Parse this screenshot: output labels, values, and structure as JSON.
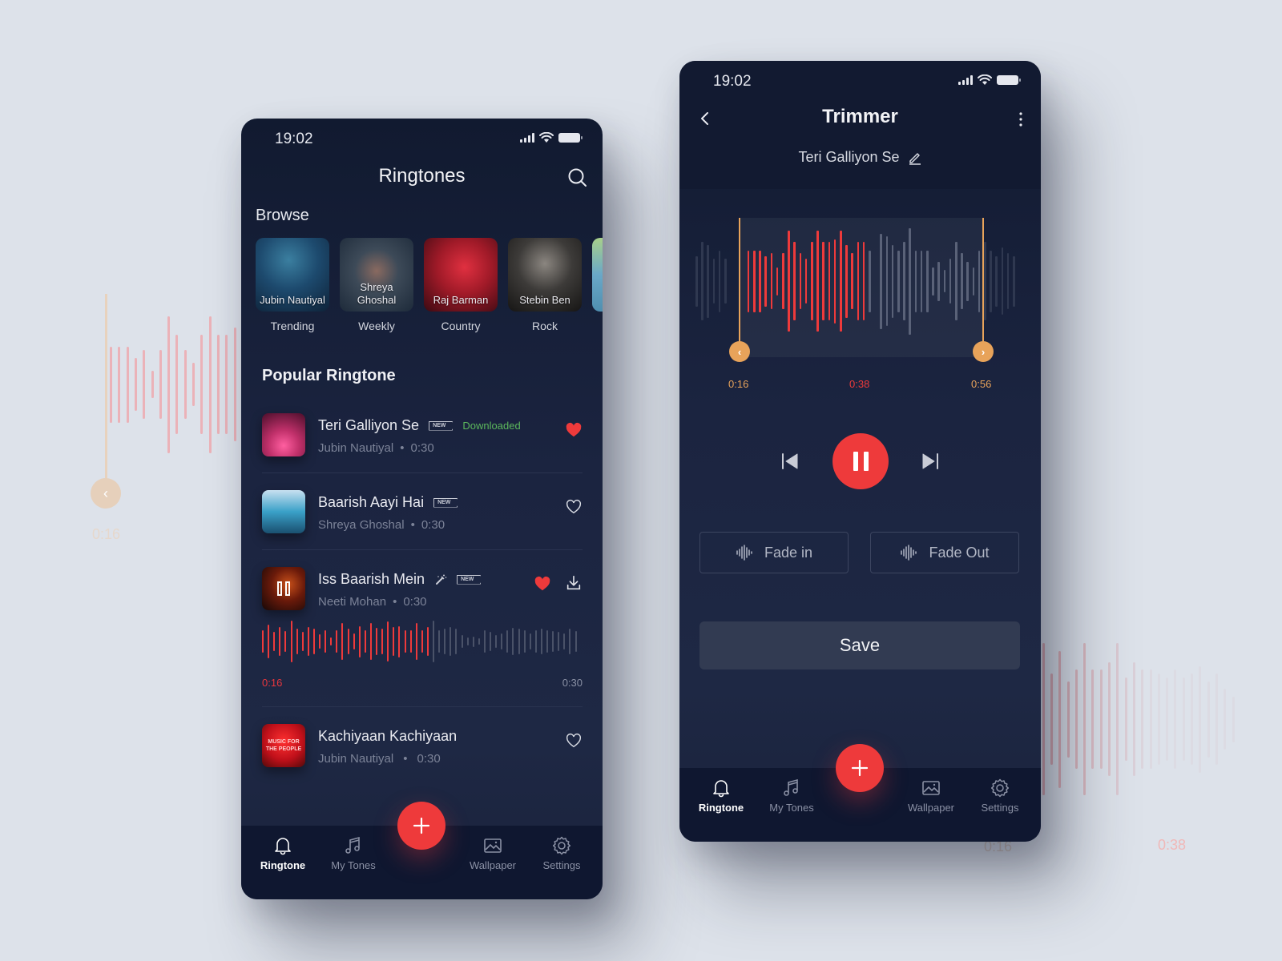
{
  "background": {
    "left_time": "0:16",
    "right_time": "0:38",
    "right_time_faded": "0:16"
  },
  "ringtones_screen": {
    "status": {
      "time": "19:02"
    },
    "title": "Ringtones",
    "browse": {
      "label": "Browse",
      "items": [
        {
          "artist": "Jubin Nautiyal",
          "category": "Trending"
        },
        {
          "artist": "Shreya Ghoshal",
          "category": "Weekly"
        },
        {
          "artist": "Raj Barman",
          "category": "Country"
        },
        {
          "artist": "Stebin Ben",
          "category": "Rock"
        }
      ]
    },
    "popular_label": "Popular Ringtone",
    "songs": [
      {
        "title": "Teri Galliyon Se",
        "badge": "NEW",
        "status": "Downloaded",
        "artist": "Jubin Nautiyal",
        "duration": "0:30",
        "liked": true
      },
      {
        "title": "Baarish Aayi Hai",
        "badge": "NEW",
        "artist": "Shreya Ghoshal",
        "duration": "0:30",
        "liked": false
      },
      {
        "title": "Iss Baarish Mein",
        "badge": "NEW",
        "artist": "Neeti Mohan",
        "duration": "0:30",
        "liked": true,
        "playing": true,
        "progress_start": "0:16",
        "progress_end": "0:30",
        "played_fraction": 0.53
      },
      {
        "title": "Kachiyaan Kachiyaan",
        "artist": "Jubin Nautiyal",
        "duration": "0:30",
        "liked": false,
        "thumb_text": "MUSIC FOR THE PEOPLE"
      }
    ],
    "separator": "•",
    "tabs": [
      {
        "label": "Ringtone",
        "icon": "bell-icon",
        "active": true
      },
      {
        "label": "My Tones",
        "icon": "music-note-icon",
        "active": false
      },
      {
        "label": "Wallpaper",
        "icon": "image-icon",
        "active": false
      },
      {
        "label": "Settings",
        "icon": "gear-icon",
        "active": false
      }
    ]
  },
  "trimmer_screen": {
    "status": {
      "time": "19:02"
    },
    "title": "Trimmer",
    "song_title": "Teri Galliyon Se",
    "trim": {
      "start": "0:16",
      "current": "0:38",
      "end": "0:56",
      "played_fraction": 0.52
    },
    "fade_in_label": "Fade in",
    "fade_out_label": "Fade Out",
    "save_label": "Save",
    "tabs": [
      {
        "label": "Ringtone",
        "icon": "bell-icon",
        "active": true
      },
      {
        "label": "My Tones",
        "icon": "music-note-icon",
        "active": false
      },
      {
        "label": "Wallpaper",
        "icon": "image-icon",
        "active": false
      },
      {
        "label": "Settings",
        "icon": "gear-icon",
        "active": false
      }
    ]
  },
  "colors": {
    "accent": "#ee3a3b",
    "handle": "#e8a35a",
    "downloaded": "#5cb85c",
    "wave_inactive": "#4a5268"
  }
}
